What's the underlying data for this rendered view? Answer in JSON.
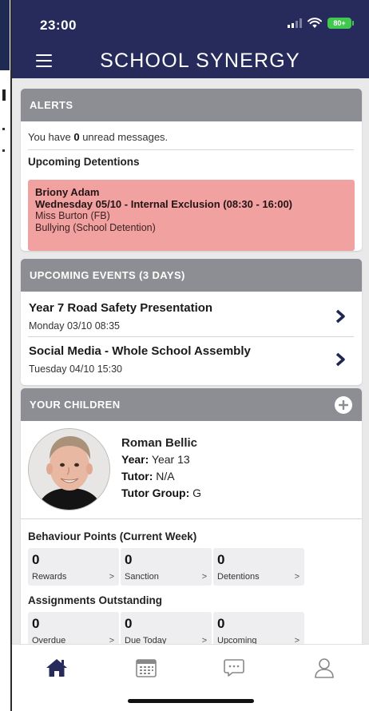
{
  "status_bar": {
    "time": "23:00",
    "battery": "80+"
  },
  "header": {
    "title": "SCHOOL SYNERGY",
    "menu_icon": "hamburger-menu-icon"
  },
  "alerts": {
    "heading": "ALERTS",
    "unread_prefix": "You have ",
    "unread_count": "0",
    "unread_suffix": " unread messages.",
    "upcoming_detentions_label": "Upcoming Detentions",
    "detention": {
      "student": "Briony Adam",
      "when": "Wednesday 05/10  - Internal Exclusion (08:30 - 16:00)",
      "teacher": "Miss Burton (FB)",
      "reason": "Bullying (School Detention)",
      "color": "#f2a1a1"
    }
  },
  "events": {
    "heading": "UPCOMING EVENTS (3 DAYS)",
    "items": [
      {
        "title": "Year 7 Road Safety Presentation",
        "date": "Monday 03/10 08:35"
      },
      {
        "title": "Social Media - Whole School Assembly",
        "date": "Tuesday 04/10 15:30"
      }
    ]
  },
  "children": {
    "heading": "YOUR CHILDREN",
    "child": {
      "name": "Roman Bellic",
      "year_label": "Year:",
      "year_value": "Year 13",
      "tutor_label": "Tutor:",
      "tutor_value": "N/A",
      "tutor_group_label": "Tutor Group:",
      "tutor_group_value": "G"
    },
    "behaviour_heading": "Behaviour Points (Current Week)",
    "behaviour": [
      {
        "value": "0",
        "label": "Rewards"
      },
      {
        "value": "0",
        "label": "Sanction"
      },
      {
        "value": "0",
        "label": "Detentions"
      }
    ],
    "assignments_heading": "Assignments Outstanding",
    "assignments": [
      {
        "value": "0",
        "label": "Overdue"
      },
      {
        "value": "0",
        "label": "Due Today"
      },
      {
        "value": "0",
        "label": "Upcoming"
      }
    ],
    "arrow": ">"
  },
  "tabs": [
    {
      "name": "home",
      "icon": "home-icon",
      "active": true
    },
    {
      "name": "calendar",
      "icon": "calendar-icon",
      "active": false
    },
    {
      "name": "messages",
      "icon": "chat-bubble-icon",
      "active": false
    },
    {
      "name": "profile",
      "icon": "person-icon",
      "active": false
    }
  ],
  "colors": {
    "header_bg": "#262b5c",
    "card_header_bg": "#8d8e93",
    "content_bg": "#e9e9ea",
    "battery": "#40c94e",
    "active_tab": "#262b5c"
  }
}
